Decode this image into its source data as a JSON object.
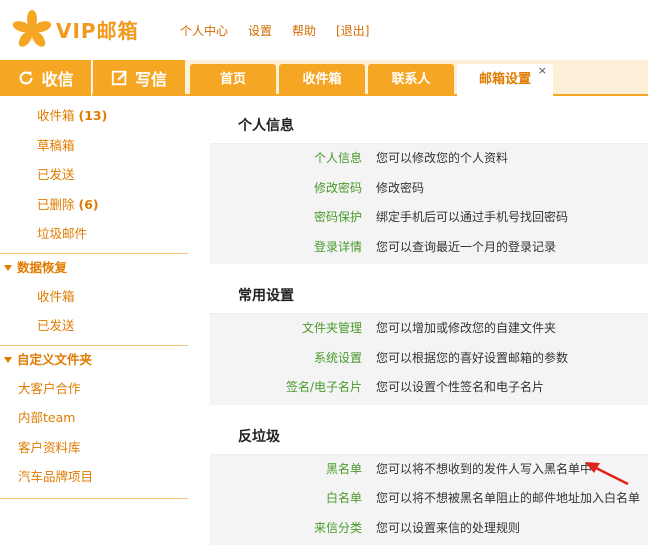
{
  "header": {
    "logo_text": "VIP邮箱",
    "nav": [
      "个人中心",
      "设置",
      "帮助",
      "[退出]"
    ]
  },
  "actions": {
    "receive": "收信",
    "compose": "写信"
  },
  "tabs": [
    {
      "label": "首页"
    },
    {
      "label": "收件箱"
    },
    {
      "label": "联系人"
    },
    {
      "label": "邮箱设置",
      "active": true,
      "close": "×"
    }
  ],
  "sidebar": {
    "folders": [
      {
        "label": "收件箱",
        "count": "(13)"
      },
      {
        "label": "草稿箱",
        "count": ""
      },
      {
        "label": "已发送",
        "count": ""
      },
      {
        "label": "已删除",
        "count": "(6)"
      },
      {
        "label": "垃圾邮件",
        "count": ""
      }
    ],
    "recovery": {
      "title": "数据恢复",
      "items": [
        "收件箱",
        "已发送"
      ]
    },
    "custom": {
      "title": "自定义文件夹",
      "items": [
        "大客户合作",
        "内部team",
        "客户资料库",
        "汽车品牌项目"
      ]
    }
  },
  "sections": [
    {
      "title": "个人信息",
      "rows": [
        {
          "key": "个人信息",
          "desc": "您可以修改您的个人资料"
        },
        {
          "key": "修改密码",
          "desc": "修改密码"
        },
        {
          "key": "密码保护",
          "desc": "绑定手机后可以通过手机号找回密码"
        },
        {
          "key": "登录详情",
          "desc": "您可以查询最近一个月的登录记录"
        }
      ]
    },
    {
      "title": "常用设置",
      "rows": [
        {
          "key": "文件夹管理",
          "desc": "您可以增加或修改您的自建文件夹"
        },
        {
          "key": "系统设置",
          "desc": "您可以根据您的喜好设置邮箱的参数"
        },
        {
          "key": "签名/电子名片",
          "desc": "您可以设置个性签名和电子名片"
        }
      ]
    },
    {
      "title": "反垃圾",
      "rows": [
        {
          "key": "黑名单",
          "desc": "您可以将不想收到的发件人写入黑名单中"
        },
        {
          "key": "白名单",
          "desc": "您可以将不想被黑名单阻止的邮件地址加入白名单"
        },
        {
          "key": "来信分类",
          "desc": "您可以设置来信的处理规则"
        }
      ]
    }
  ],
  "colors": {
    "accent": "#f5a623",
    "link_orange": "#e07b00",
    "link_green": "#4a9a2b",
    "annotation_arrow": "#e0201a"
  }
}
